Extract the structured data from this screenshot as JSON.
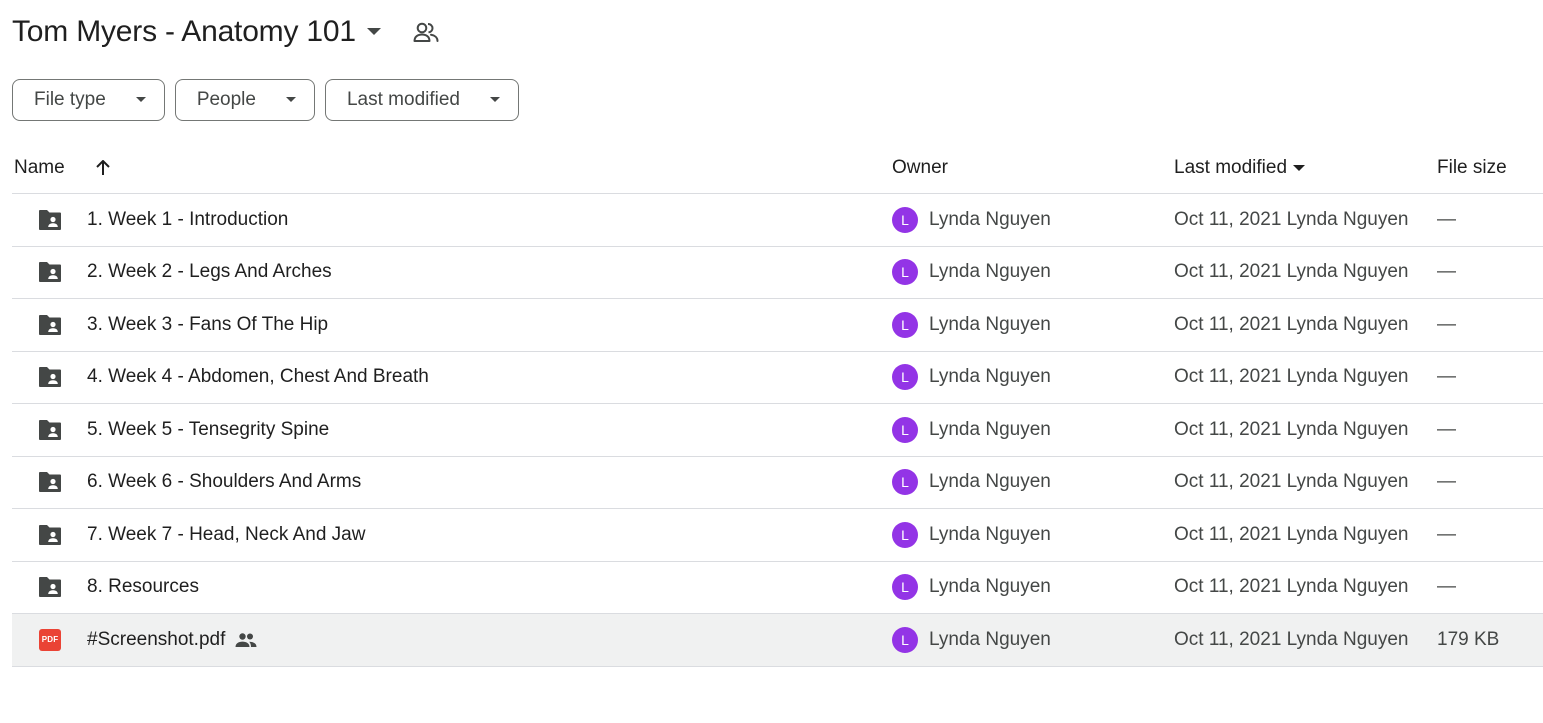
{
  "header": {
    "title": "Tom Myers - Anatomy 101"
  },
  "filters": [
    {
      "label": "File type"
    },
    {
      "label": "People"
    },
    {
      "label": "Last modified"
    }
  ],
  "columns": {
    "name": "Name",
    "owner": "Owner",
    "modified": "Last modified",
    "size": "File size"
  },
  "rows": [
    {
      "name": "1. Week 1 - Introduction",
      "type": "shared-folder",
      "owner_initial": "L",
      "owner": "Lynda Nguyen",
      "modified": "Oct 11, 2021 Lynda Nguyen",
      "size": "—"
    },
    {
      "name": "2. Week 2 - Legs And Arches",
      "type": "shared-folder",
      "owner_initial": "L",
      "owner": "Lynda Nguyen",
      "modified": "Oct 11, 2021 Lynda Nguyen",
      "size": "—"
    },
    {
      "name": "3. Week 3 - Fans Of The Hip",
      "type": "shared-folder",
      "owner_initial": "L",
      "owner": "Lynda Nguyen",
      "modified": "Oct 11, 2021 Lynda Nguyen",
      "size": "—"
    },
    {
      "name": "4. Week 4 - Abdomen, Chest And Breath",
      "type": "shared-folder",
      "owner_initial": "L",
      "owner": "Lynda Nguyen",
      "modified": "Oct 11, 2021 Lynda Nguyen",
      "size": "—"
    },
    {
      "name": "5. Week 5 - Tensegrity Spine",
      "type": "shared-folder",
      "owner_initial": "L",
      "owner": "Lynda Nguyen",
      "modified": "Oct 11, 2021 Lynda Nguyen",
      "size": "—"
    },
    {
      "name": "6. Week 6 - Shoulders And Arms",
      "type": "shared-folder",
      "owner_initial": "L",
      "owner": "Lynda Nguyen",
      "modified": "Oct 11, 2021 Lynda Nguyen",
      "size": "—"
    },
    {
      "name": "7. Week 7 - Head, Neck And Jaw",
      "type": "shared-folder",
      "owner_initial": "L",
      "owner": "Lynda Nguyen",
      "modified": "Oct 11, 2021 Lynda Nguyen",
      "size": "—"
    },
    {
      "name": "8. Resources",
      "type": "shared-folder",
      "owner_initial": "L",
      "owner": "Lynda Nguyen",
      "modified": "Oct 11, 2021 Lynda Nguyen",
      "size": "—"
    },
    {
      "name": "#Screenshot.pdf",
      "type": "pdf",
      "pdf_label": "PDF",
      "shared": true,
      "owner_initial": "L",
      "owner": "Lynda Nguyen",
      "modified": "Oct 11, 2021 Lynda Nguyen",
      "size": "179 KB"
    }
  ],
  "colors": {
    "avatar": "#9334e6",
    "pdf": "#ea4335",
    "folder": "#444746",
    "selected_row": "#f0f1f1"
  },
  "icons": {
    "title_caret": "caret-down-icon",
    "share": "people-outline-icon",
    "sort": "arrow-up-icon",
    "folder": "shared-folder-icon",
    "pdf": "pdf-icon",
    "shared": "people-icon"
  }
}
